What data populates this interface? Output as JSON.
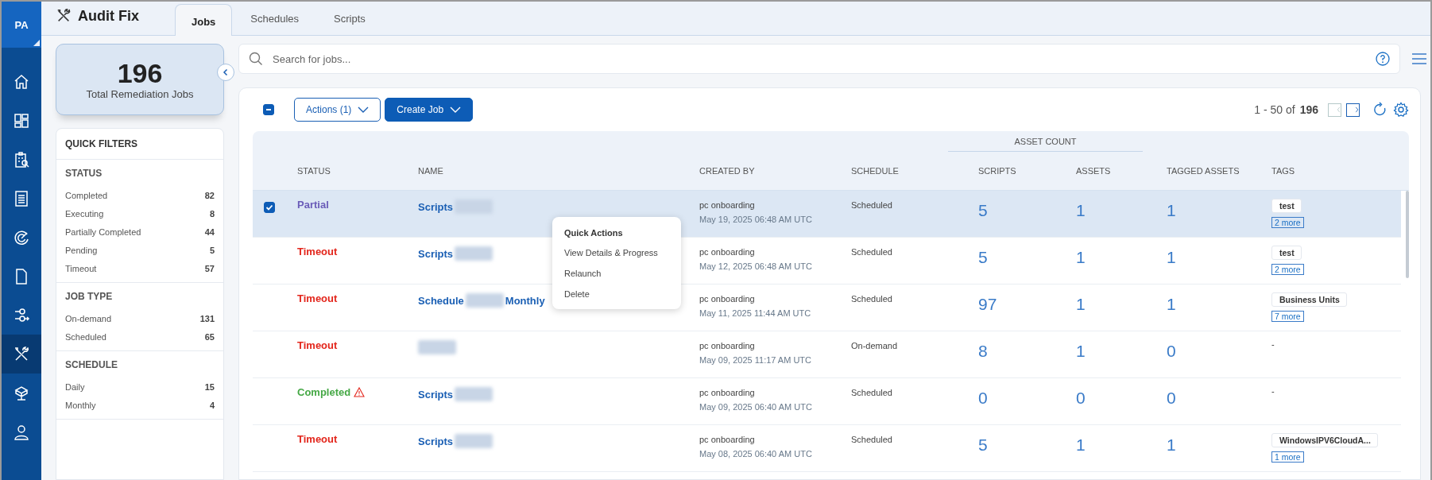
{
  "user": {
    "initials": "PA"
  },
  "nav": {
    "items": [
      {
        "selected": false
      },
      {
        "selected": false
      },
      {
        "selected": false
      },
      {
        "selected": false
      },
      {
        "selected": false
      },
      {
        "selected": false
      },
      {
        "selected": false
      },
      {
        "selected": true
      },
      {
        "selected": false
      },
      {
        "selected": false
      }
    ]
  },
  "app": {
    "title": "Audit Fix"
  },
  "tabs": [
    {
      "label": "Jobs",
      "selected": true
    },
    {
      "label": "Schedules",
      "selected": false
    },
    {
      "label": "Scripts",
      "selected": false
    }
  ],
  "summary": {
    "count": "196",
    "label": "Total Remediation Jobs"
  },
  "quick_filters": {
    "title": "QUICK FILTERS",
    "sections": [
      {
        "title": "STATUS",
        "items": [
          {
            "label": "Completed",
            "count": "82"
          },
          {
            "label": "Executing",
            "count": "8"
          },
          {
            "label": "Partially Completed",
            "count": "44"
          },
          {
            "label": "Pending",
            "count": "5"
          },
          {
            "label": "Timeout",
            "count": "57"
          }
        ]
      },
      {
        "title": "JOB TYPE",
        "items": [
          {
            "label": "On-demand",
            "count": "131"
          },
          {
            "label": "Scheduled",
            "count": "65"
          }
        ]
      },
      {
        "title": "SCHEDULE",
        "items": [
          {
            "label": "Daily",
            "count": "15"
          },
          {
            "label": "Monthly",
            "count": "4"
          }
        ]
      }
    ]
  },
  "search": {
    "placeholder": "Search for jobs..."
  },
  "toolbar": {
    "select_all_partial": true,
    "actions_button": "Actions (1)",
    "create_button": "Create Job",
    "range": "1 - 50 of",
    "total": "196",
    "prev_disabled": true,
    "next_disabled": false
  },
  "table": {
    "group_header": "ASSET COUNT",
    "columns": [
      "STATUS",
      "NAME",
      "CREATED BY",
      "SCHEDULE",
      "SCRIPTS",
      "ASSETS",
      "TAGGED ASSETS",
      "TAGS"
    ],
    "rows": [
      {
        "selected": true,
        "status": {
          "label": "Partial",
          "color": "#6a5cb8",
          "warning": false
        },
        "name": [
          {
            "kind": "text",
            "text": "Scripts"
          },
          {
            "kind": "redacted"
          }
        ],
        "created_by": "pc onboarding",
        "created_at": "May 19, 2025 06:48 AM UTC",
        "schedule": "Scheduled",
        "scripts": "5",
        "assets": "1",
        "tagged_assets": "1",
        "tags": {
          "label": "test",
          "more": "2 more"
        }
      },
      {
        "selected": false,
        "status": {
          "label": "Timeout",
          "color": "#e3261c",
          "warning": false
        },
        "name": [
          {
            "kind": "text",
            "text": "Scripts"
          },
          {
            "kind": "redacted"
          }
        ],
        "created_by": "pc onboarding",
        "created_at": "May 12, 2025 06:48 AM UTC",
        "schedule": "Scheduled",
        "scripts": "5",
        "assets": "1",
        "tagged_assets": "1",
        "tags": {
          "label": "test",
          "more": "2 more"
        }
      },
      {
        "selected": false,
        "status": {
          "label": "Timeout",
          "color": "#e3261c",
          "warning": false
        },
        "name": [
          {
            "kind": "text",
            "text": "Schedule"
          },
          {
            "kind": "redacted"
          },
          {
            "kind": "text",
            "text": "Monthly"
          }
        ],
        "created_by": "pc onboarding",
        "created_at": "May 11, 2025 11:44 AM UTC",
        "schedule": "Scheduled",
        "scripts": "97",
        "assets": "1",
        "tagged_assets": "1",
        "tags": {
          "label": "Business Units",
          "more": "7 more"
        }
      },
      {
        "selected": false,
        "status": {
          "label": "Timeout",
          "color": "#e3261c",
          "warning": false
        },
        "name": [
          {
            "kind": "redacted"
          }
        ],
        "created_by": "pc onboarding",
        "created_at": "May 09, 2025 11:17 AM UTC",
        "schedule": "On-demand",
        "scripts": "8",
        "assets": "1",
        "tagged_assets": "0",
        "tags": {
          "empty": "-"
        }
      },
      {
        "selected": false,
        "status": {
          "label": "Completed",
          "color": "#45a845",
          "warning": true
        },
        "name": [
          {
            "kind": "text",
            "text": "Scripts"
          },
          {
            "kind": "redacted"
          }
        ],
        "created_by": "pc onboarding",
        "created_at": "May 09, 2025 06:40 AM UTC",
        "schedule": "Scheduled",
        "scripts": "0",
        "assets": "0",
        "tagged_assets": "0",
        "tags": {
          "empty": "-"
        }
      },
      {
        "selected": false,
        "status": {
          "label": "Timeout",
          "color": "#e3261c",
          "warning": false
        },
        "name": [
          {
            "kind": "text",
            "text": "Scripts"
          },
          {
            "kind": "redacted"
          }
        ],
        "created_by": "pc onboarding",
        "created_at": "May 08, 2025 06:40 AM UTC",
        "schedule": "Scheduled",
        "scripts": "5",
        "assets": "1",
        "tagged_assets": "1",
        "tags": {
          "label": "WindowsIPV6CloudA...",
          "more": "1 more"
        }
      }
    ]
  },
  "context_menu": {
    "title": "Quick Actions",
    "items": [
      "View Details & Progress",
      "Relaunch",
      "Delete"
    ]
  }
}
